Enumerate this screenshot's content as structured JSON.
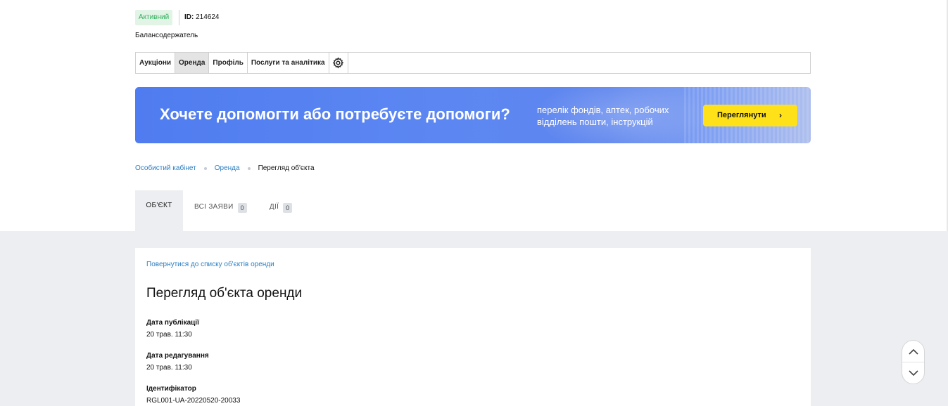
{
  "header": {
    "status": "Активний",
    "id_label": "ID:",
    "id_value": "214624",
    "role": "Балансодержатель"
  },
  "nav": {
    "tabs": [
      {
        "label": "Аукціони",
        "active": false
      },
      {
        "label": "Оренда",
        "active": true
      },
      {
        "label": "Профіль",
        "active": false
      },
      {
        "label": "Послуги та аналітика",
        "active": false
      }
    ],
    "settings_icon": "gear-icon"
  },
  "banner": {
    "title": "Хочете допомогти або потребуєте допомоги?",
    "subtitle": "перелік фондів, аптек, робочих відділень пошти, інструкцій",
    "button": "Переглянути",
    "button_icon": "chevron-right-icon",
    "button_color": "#ffe11a"
  },
  "breadcrumb": {
    "items": [
      "Особистий кабінет",
      "Оренда",
      "Перегляд об'єкта"
    ]
  },
  "tabs": {
    "object": "ОБ'ЄКТ",
    "all_bids": "ВСІ ЗАЯВИ",
    "all_bids_count": "0",
    "actions": "ДІЇ",
    "actions_count": "0"
  },
  "card": {
    "back_link": "Повернутися до списку об'єктів оренди",
    "title": "Перегляд об'єкта оренди",
    "fields": [
      {
        "label": "Дата публікації",
        "value": "20 трав. 11:30"
      },
      {
        "label": "Дата редагування",
        "value": "20 трав. 11:30"
      },
      {
        "label": "Ідентифікатор",
        "value": "RGL001-UA-20220520-20033"
      }
    ]
  },
  "scroll": {
    "up_icon": "chevron-up-icon",
    "down_icon": "chevron-down-icon"
  },
  "colors": {
    "link": "#2b7ec2",
    "status_green": "#2eae59",
    "banner_blue": "#5c87f2",
    "page_gray": "#eceef1"
  }
}
